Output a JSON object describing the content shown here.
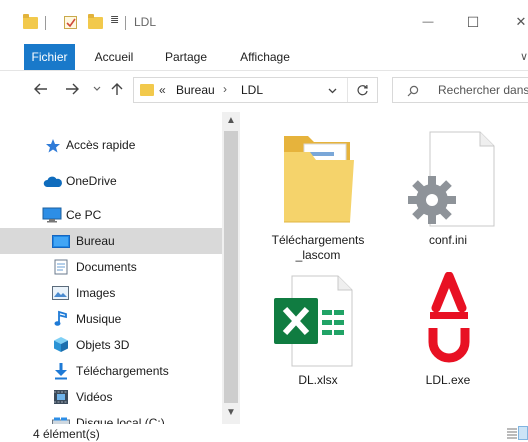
{
  "window": {
    "title": "LDL",
    "qa_arrow": "≣",
    "minimize": "—",
    "maximize": "☐",
    "close": "✕"
  },
  "ribbon": {
    "tabs": [
      {
        "label": "Fichier",
        "active": true
      },
      {
        "label": "Accueil",
        "active": false
      },
      {
        "label": "Partage",
        "active": false
      },
      {
        "label": "Affichage",
        "active": false
      }
    ]
  },
  "address": {
    "prefix": "«",
    "crumbs": [
      "Bureau",
      "LDL"
    ],
    "separator": "›"
  },
  "search": {
    "placeholder": "Rechercher dans"
  },
  "sidebar": {
    "items": [
      {
        "label": "Accès rapide",
        "icon": "star-icon"
      },
      {
        "label": "OneDrive",
        "icon": "cloud-icon"
      },
      {
        "label": "Ce PC",
        "icon": "computer-icon"
      },
      {
        "label": "Bureau",
        "icon": "desktop-icon",
        "selected": true
      },
      {
        "label": "Documents",
        "icon": "documents-icon"
      },
      {
        "label": "Images",
        "icon": "images-icon"
      },
      {
        "label": "Musique",
        "icon": "music-icon"
      },
      {
        "label": "Objets 3D",
        "icon": "cube-icon"
      },
      {
        "label": "Téléchargements",
        "icon": "download-icon"
      },
      {
        "label": "Vidéos",
        "icon": "video-icon"
      },
      {
        "label": "Disque local (C:)",
        "icon": "disk-icon"
      }
    ]
  },
  "files": [
    {
      "name": "Téléchargements\n_lascom",
      "icon": "folder-icon"
    },
    {
      "name": "conf.ini",
      "icon": "config-file-icon"
    },
    {
      "name": "DL.xlsx",
      "icon": "excel-icon"
    },
    {
      "name": "LDL.exe",
      "icon": "exe-app-icon"
    }
  ],
  "status": {
    "count": "4 élément(s)"
  },
  "colors": {
    "accent": "#1979ca",
    "folder": "#f2c94c",
    "excel": "#107c41",
    "exe": "#e81123",
    "selected": "#d9d9d9"
  }
}
